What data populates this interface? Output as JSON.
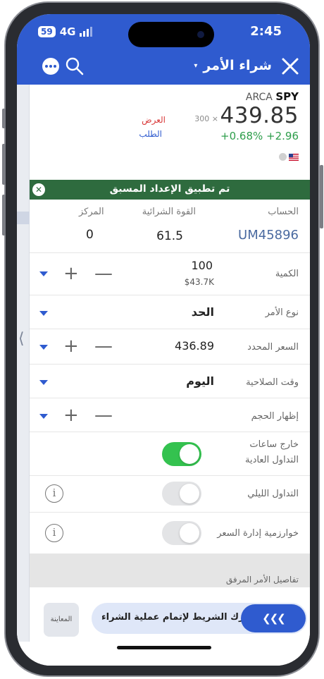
{
  "status": {
    "battery": "59",
    "network": "4G",
    "time": "2:45"
  },
  "header": {
    "title": "شراء الأمر",
    "caret": "▾",
    "more_icon": "more-icon",
    "search_icon": "search-icon",
    "close_icon": "close-icon"
  },
  "quote": {
    "exchange": "ARCA",
    "symbol": "SPY",
    "price": "439.85",
    "size": "300 ×",
    "change": "+0.68% +2.96",
    "ask_label": "العرض",
    "bid_label": "الطلب"
  },
  "banner": {
    "text": "تم تطبيق الإعداد المسبق",
    "close": "✕"
  },
  "account": {
    "account_label": "الحساب",
    "account_value": "UM45896",
    "buying_power_label": "القوة الشرائية",
    "buying_power_value": "61.5",
    "position_label": "المركز",
    "position_value": "0"
  },
  "fields": {
    "quantity_label": "الكمية",
    "quantity_value": "100",
    "quantity_sub": "$43.7K",
    "order_type_label": "نوع الأمر",
    "order_type_value": "الحد",
    "limit_price_label": "السعر المحدد",
    "limit_price_value": "436.89",
    "tif_label": "وقت الصلاحية",
    "tif_value": "اليوم",
    "display_size_label": "إظهار الحجم",
    "outside_rth_label_1": "خارج ساعات",
    "outside_rth_label_2": "التداول العادية",
    "outside_rth_on": true,
    "overnight_label": "التداول الليلي",
    "overnight_on": false,
    "price_mgmt_label": "خوارزمية إدارة السعر",
    "price_mgmt_on": false,
    "plus": "+",
    "minus": "—",
    "info": "i"
  },
  "attached": {
    "label": "تفاصيل الأمر المرفق"
  },
  "bottom": {
    "preview_label": "المعاينة",
    "slide_text": "حرك الشريط لإتمام عملية الشراء",
    "slide_knob": "❮❮❮"
  },
  "colors": {
    "brand_blue": "#2f5bcf",
    "banner_green": "#2e6b3e",
    "up_green": "#2e9e4b",
    "ask_red": "#d93a3a",
    "toggle_on": "#34c24f"
  }
}
